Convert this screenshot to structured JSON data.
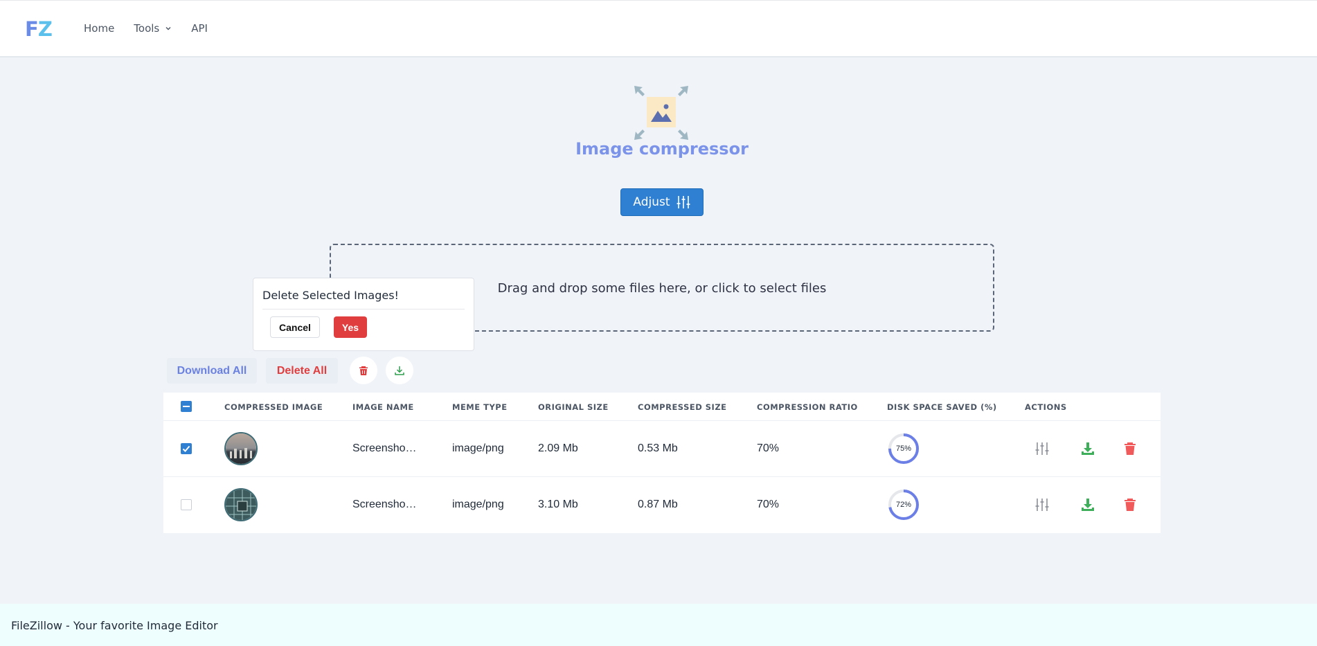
{
  "brand": {
    "logo_f": "F",
    "logo_z": "Z",
    "logo_color_f": "#6b8ce6",
    "logo_color_z": "#5bc0eb"
  },
  "nav": {
    "home": "Home",
    "tools": "Tools",
    "api": "API"
  },
  "hero": {
    "title": "Image compressor",
    "icon": "image-compress-icon",
    "adjust_label": "Adjust",
    "adjust_icon": "sliders-icon"
  },
  "dropzone": {
    "text": "Drag and drop some files here, or click to select files"
  },
  "popover": {
    "title": "Delete Selected Images!",
    "cancel": "Cancel",
    "yes": "Yes"
  },
  "actions": {
    "download_all": "Download All",
    "delete_all": "Delete All"
  },
  "table": {
    "headers": [
      "COMPRESSED IMAGE",
      "IMAGE NAME",
      "MEME TYPE",
      "ORIGINAL SIZE",
      "COMPRESSED SIZE",
      "COMPRESSION RATIO",
      "DISK SPACE SAVED (%)",
      "ACTIONS"
    ],
    "rows": [
      {
        "checked": true,
        "name": "Screensho…",
        "type": "image/png",
        "original": "2.09 Mb",
        "compressed": "0.53 Mb",
        "ratio": "70%",
        "saved_label": "75%",
        "saved": 75
      },
      {
        "checked": false,
        "name": "Screensho…",
        "type": "image/png",
        "original": "3.10 Mb",
        "compressed": "0.87 Mb",
        "ratio": "70%",
        "saved_label": "72%",
        "saved": 72
      }
    ]
  },
  "footer": {
    "text": "FileZillow - Your favorite Image Editor"
  },
  "colors": {
    "primary": "#2f80d3",
    "danger": "#e03e3e",
    "success": "#3fae5a",
    "gauge": "#6b7fe6"
  }
}
